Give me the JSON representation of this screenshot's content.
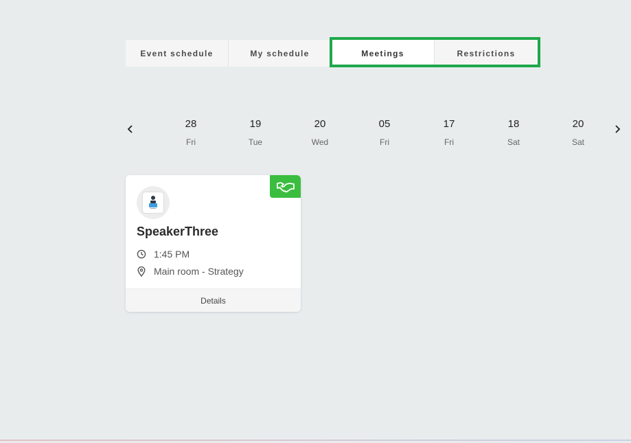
{
  "tabs": [
    {
      "label": "Event schedule",
      "active": false
    },
    {
      "label": "My schedule",
      "active": false
    },
    {
      "label": "Meetings",
      "active": true
    },
    {
      "label": "Restrictions",
      "active": false
    }
  ],
  "highlight_color": "#1fa84a",
  "date_strip": {
    "prev_icon": "chevron-left-icon",
    "next_icon": "chevron-right-icon",
    "days": [
      {
        "num": "28",
        "weekday": "Fri"
      },
      {
        "num": "19",
        "weekday": "Tue"
      },
      {
        "num": "20",
        "weekday": "Wed"
      },
      {
        "num": "05",
        "weekday": "Fri"
      },
      {
        "num": "17",
        "weekday": "Fri"
      },
      {
        "num": "18",
        "weekday": "Sat"
      },
      {
        "num": "20",
        "weekday": "Sat"
      }
    ]
  },
  "meeting_card": {
    "badge_icon": "handshake-icon",
    "badge_color": "#3bbd3f",
    "speaker": "SpeakerThree",
    "time": "1:45 PM",
    "location": "Main room - Strategy",
    "details_label": "Details"
  }
}
